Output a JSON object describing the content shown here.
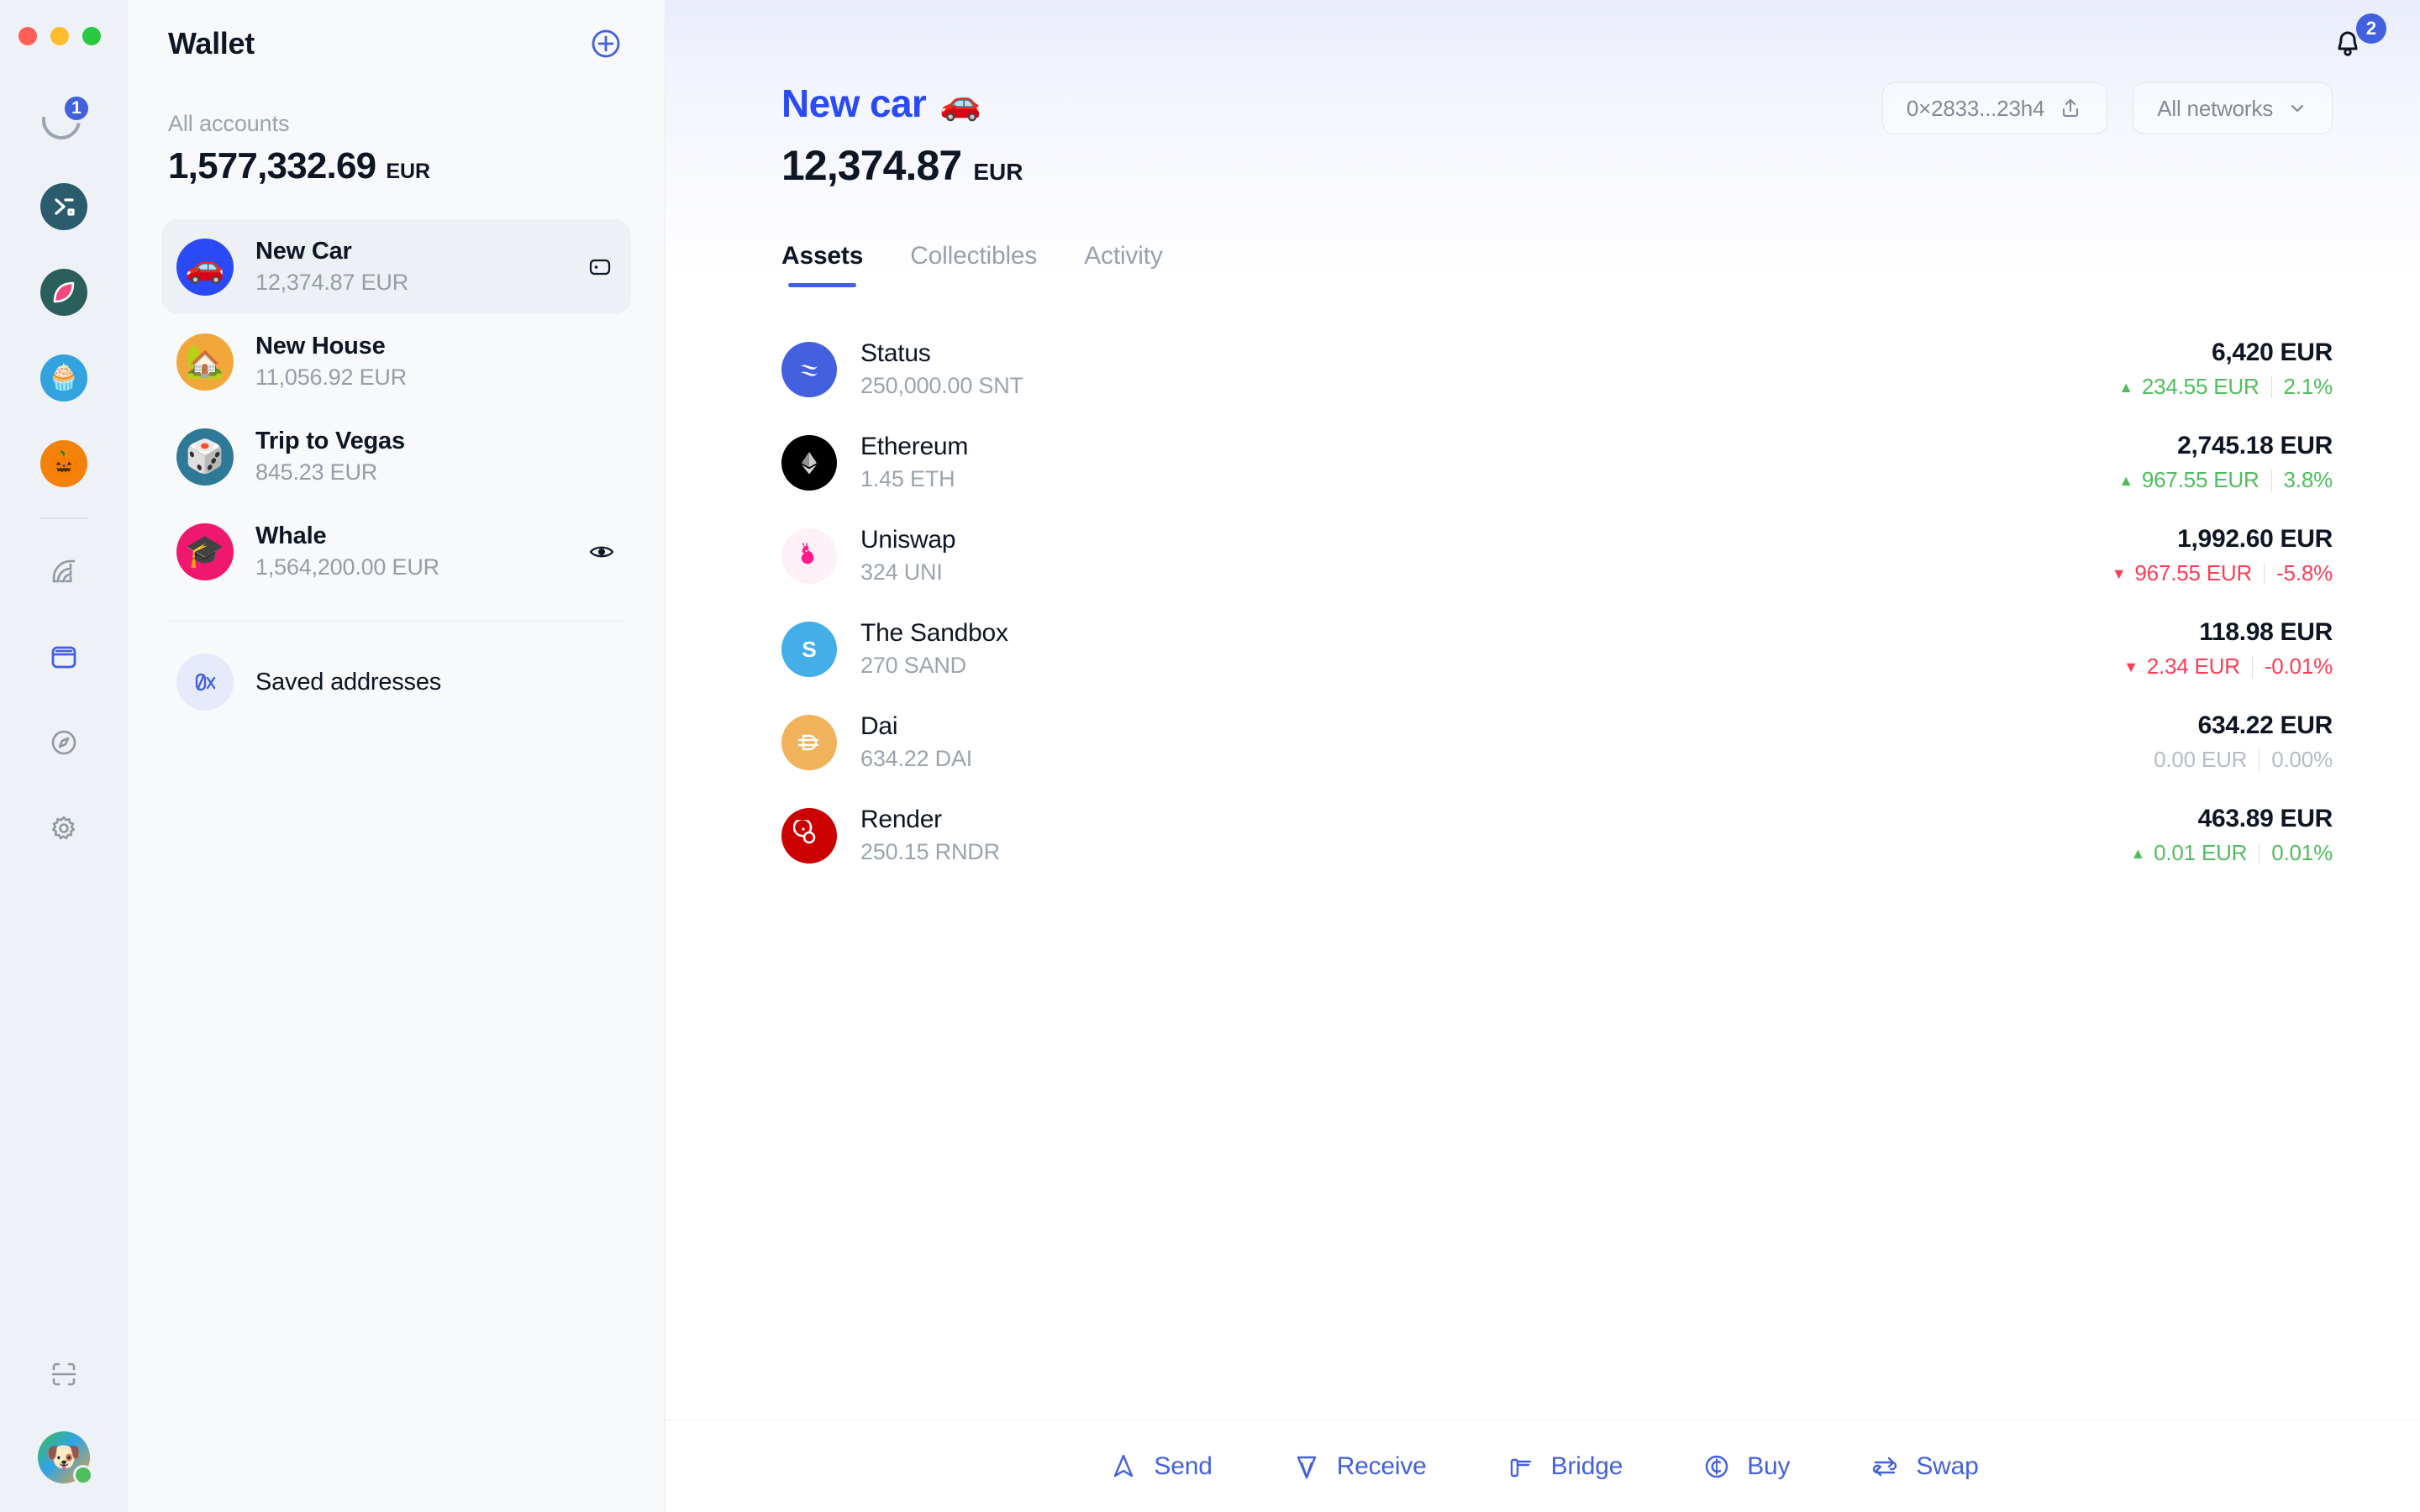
{
  "window": {
    "traffic_lights": [
      "close",
      "minimize",
      "zoom"
    ]
  },
  "rail": {
    "sync_badge": "1",
    "items": [
      {
        "name": "sync-status",
        "label": "Sync status",
        "icon": "arc-badge"
      },
      {
        "name": "community-status",
        "label": "Status",
        "icon": "status-logo",
        "color": "#2A5C6E",
        "glyph": "𝙭"
      },
      {
        "name": "community-watermelon",
        "label": "Watermelon",
        "icon": "watermelon-logo",
        "color": "#2A5F5C",
        "glyph": "🍉"
      },
      {
        "name": "community-cupcake",
        "label": "Cupcake",
        "icon": "cupcake-logo",
        "color": "#33A3E0",
        "glyph": "🧁"
      },
      {
        "name": "community-punk",
        "label": "Punk",
        "icon": "punk-logo",
        "color": "#F2820C",
        "glyph": "🎃"
      }
    ],
    "nav": [
      {
        "name": "rainbow",
        "label": "Communities",
        "icon": "rainbow-icon",
        "active": false
      },
      {
        "name": "wallet",
        "label": "Wallet",
        "icon": "wallet-icon",
        "active": true
      },
      {
        "name": "browser",
        "label": "Browser",
        "icon": "compass-icon",
        "active": false
      },
      {
        "name": "settings",
        "label": "Settings",
        "icon": "gear-icon",
        "active": false
      }
    ],
    "bottom": [
      {
        "name": "scan",
        "label": "Scan QR",
        "icon": "scan-icon"
      },
      {
        "name": "profile",
        "label": "Profile",
        "icon": "avatar",
        "glyph": "🐶",
        "presence": "online"
      }
    ]
  },
  "sidebar": {
    "title": "Wallet",
    "add_button_label": "+",
    "all_accounts_label": "All accounts",
    "all_accounts_amount": "1,577,332.69",
    "all_accounts_currency": "EUR",
    "accounts": [
      {
        "name": "New Car",
        "balance": "12,374.87 EUR",
        "emoji": "🚗",
        "color": "#2A4AF5",
        "active": true,
        "action_icon": "keycard-icon"
      },
      {
        "name": "New House",
        "balance": "11,056.92 EUR",
        "emoji": "🏡",
        "color": "#F2A73B",
        "active": false,
        "action_icon": ""
      },
      {
        "name": "Trip to Vegas",
        "balance": "845.23 EUR",
        "emoji": "🎲",
        "color": "#2E7A96",
        "active": false,
        "action_icon": ""
      },
      {
        "name": "Whale",
        "balance": "1,564,200.00 EUR",
        "emoji": "🎓",
        "color": "#F0186E",
        "active": false,
        "action_icon": "eye-icon"
      }
    ],
    "saved_addresses_label": "Saved addresses",
    "saved_addresses_icon": "0x-icon"
  },
  "main": {
    "notifications_count": "2",
    "account_name": "New car",
    "account_emoji": "🚗",
    "account_total": "12,374.87",
    "account_currency": "EUR",
    "address_chip": "0×2833...23h4",
    "network_selector": "All networks",
    "tabs": [
      {
        "label": "Assets",
        "active": true
      },
      {
        "label": "Collectibles",
        "active": false
      },
      {
        "label": "Activity",
        "active": false
      }
    ],
    "assets": [
      {
        "name": "Status",
        "amount": "250,000.00 SNT",
        "value": "6,420 EUR",
        "change": "234.55 EUR",
        "percent": "2.1%",
        "direction": "up",
        "icon": "status-token",
        "color": "#4360DF"
      },
      {
        "name": "Ethereum",
        "amount": "1.45 ETH",
        "value": "2,745.18 EUR",
        "change": "967.55 EUR",
        "percent": "3.8%",
        "direction": "up",
        "icon": "ethereum-token",
        "color": "#000000"
      },
      {
        "name": "Uniswap",
        "amount": "324 UNI",
        "value": "1,992.60 EUR",
        "change": "967.55 EUR",
        "percent": "-5.8%",
        "direction": "down",
        "icon": "uniswap-token",
        "color": "#FDF0F6"
      },
      {
        "name": "The Sandbox",
        "amount": "270 SAND",
        "value": "118.98 EUR",
        "change": "2.34 EUR",
        "percent": "-0.01%",
        "direction": "down",
        "icon": "sandbox-token",
        "color": "#44AEE8"
      },
      {
        "name": "Dai",
        "amount": "634.22 DAI",
        "value": "634.22 EUR",
        "change": "0.00 EUR",
        "percent": "0.00%",
        "direction": "flat",
        "icon": "dai-token",
        "color": "#F0B35B"
      },
      {
        "name": "Render",
        "amount": "250.15 RNDR",
        "value": "463.89 EUR",
        "change": "0.01 EUR",
        "percent": "0.01%",
        "direction": "up",
        "icon": "render-token",
        "color": "#CC0000"
      }
    ]
  },
  "footer": {
    "actions": [
      {
        "label": "Send",
        "icon": "send-icon"
      },
      {
        "label": "Receive",
        "icon": "receive-icon"
      },
      {
        "label": "Bridge",
        "icon": "bridge-icon"
      },
      {
        "label": "Buy",
        "icon": "buy-icon"
      },
      {
        "label": "Swap",
        "icon": "swap-icon"
      }
    ]
  },
  "colors": {
    "accent": "#4360DF",
    "title_blue": "#2A4AF5",
    "positive": "#4EBE5C",
    "negative": "#FF3D55",
    "neutral": "#B5BCC5"
  }
}
